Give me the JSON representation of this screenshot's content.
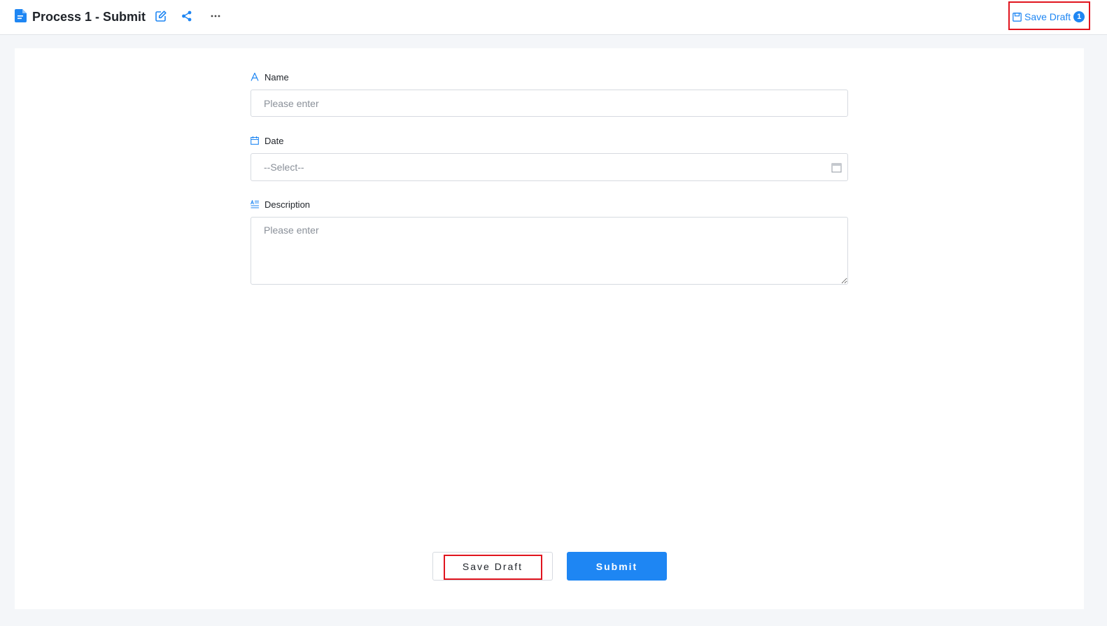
{
  "header": {
    "title": "Process 1 - Submit",
    "save_draft_label": "Save Draft",
    "draft_count": "1",
    "icons": [
      "document-icon",
      "edit-icon",
      "share-icon",
      "more-icon",
      "save-icon"
    ]
  },
  "form": {
    "name": {
      "label": "Name",
      "placeholder": "Please enter",
      "icon": "text-icon"
    },
    "date": {
      "label": "Date",
      "value": "--Select--",
      "icon": "calendar-icon"
    },
    "description": {
      "label": "Description",
      "placeholder": "Please enter",
      "icon": "paragraph-icon"
    }
  },
  "actions": {
    "save_draft_label": "Save Draft",
    "submit_label": "Submit"
  },
  "colors": {
    "accent": "#1e86f3",
    "highlight": "#e0141e",
    "page_bg": "#f4f6f9"
  }
}
